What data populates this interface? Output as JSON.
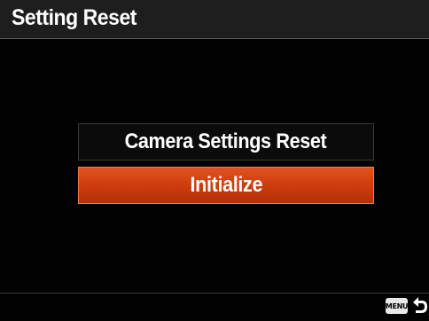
{
  "header": {
    "title": "Setting Reset"
  },
  "menu": {
    "items": [
      {
        "label": "Camera Settings Reset",
        "selected": false
      },
      {
        "label": "Initialize",
        "selected": true
      }
    ]
  },
  "footer": {
    "menu_key_label": "MENU",
    "return_icon": "return-arrow-icon"
  },
  "colors": {
    "background": "#000000",
    "selected_highlight": "#d2420f",
    "text": "#ffffff"
  }
}
